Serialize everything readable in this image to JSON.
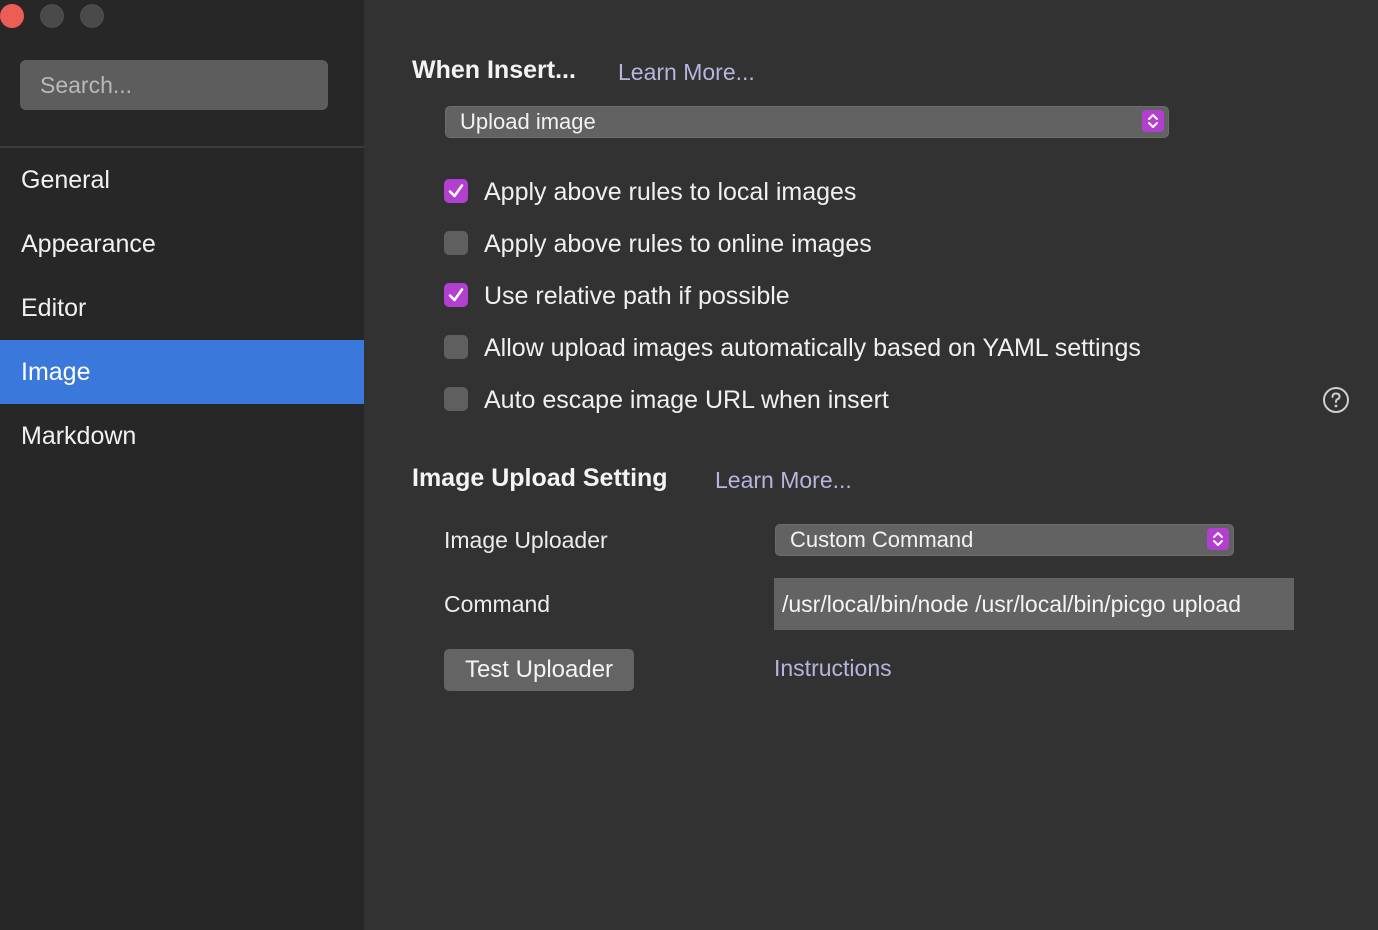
{
  "window": {
    "controls": [
      "close",
      "minimize",
      "maximize"
    ],
    "colors": {
      "close": "#ec5e55",
      "inactive": "#4a4a4a"
    }
  },
  "sidebar": {
    "search_placeholder": "Search...",
    "items": [
      {
        "label": "General",
        "active": false
      },
      {
        "label": "Appearance",
        "active": false
      },
      {
        "label": "Editor",
        "active": false
      },
      {
        "label": "Image",
        "active": true
      },
      {
        "label": "Markdown",
        "active": false
      }
    ],
    "active_color": "#3a78db"
  },
  "when_insert": {
    "title": "When Insert...",
    "learn_more": "Learn More...",
    "select_value": "Upload image",
    "options": [
      {
        "label": "Apply above rules to local images",
        "checked": true
      },
      {
        "label": "Apply above rules to online images",
        "checked": false
      },
      {
        "label": "Use relative path if possible",
        "checked": true
      },
      {
        "label": "Allow upload images automatically based on YAML settings",
        "checked": false
      },
      {
        "label": "Auto escape image URL when insert",
        "checked": false
      }
    ],
    "help_icon": "question-circle-icon"
  },
  "upload_setting": {
    "title": "Image Upload Setting",
    "learn_more": "Learn More...",
    "uploader_label": "Image Uploader",
    "uploader_value": "Custom Command",
    "command_label": "Command",
    "command_value": "/usr/local/bin/node /usr/local/bin/picgo upload",
    "test_button": "Test Uploader",
    "instructions_link": "Instructions"
  },
  "accent_color": "#b23fd0"
}
